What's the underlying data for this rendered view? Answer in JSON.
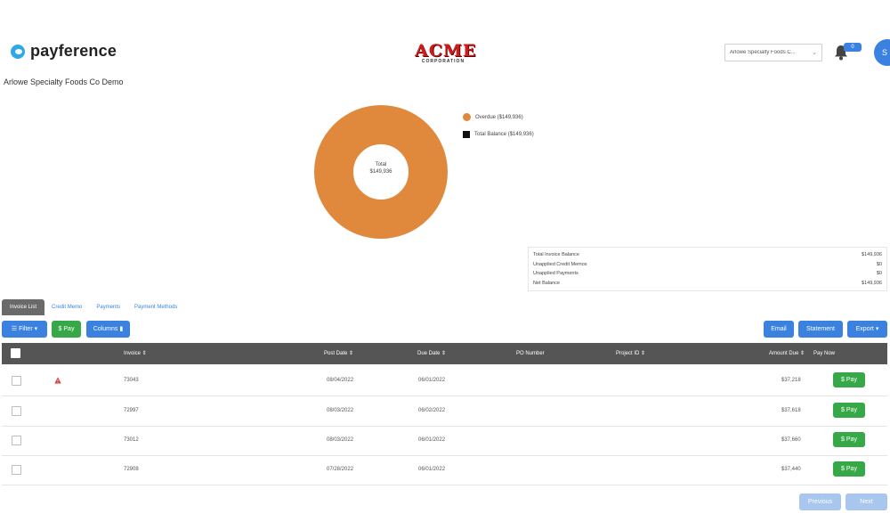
{
  "header": {
    "brand_name": "payference",
    "acme_logo_text": "ACME",
    "acme_logo_subtext": "CORPORATION",
    "account_select_value": "Arlowe Specialty Foods C...",
    "notification_count": "0",
    "avatar_initial": "S"
  },
  "company_name": "Arlowe Specialty Foods Co Demo",
  "chart_data": {
    "type": "pie",
    "categories": [
      "Overdue ($149,936)",
      "Total Balance ($149,936)"
    ],
    "values": [
      149936,
      0
    ],
    "center_label": "Total",
    "center_value": "$149,936",
    "colors": [
      "#e0893d",
      "#111111"
    ],
    "legend_placement": "right"
  },
  "summary": {
    "rows": [
      {
        "label": "Total Invoice Balance",
        "value": "$149,936"
      },
      {
        "label": "Unapplied Credit Memos",
        "value": "$0"
      },
      {
        "label": "Unapplied Payments",
        "value": "$0"
      },
      {
        "label": "Net Balance",
        "value": "$149,936"
      }
    ]
  },
  "tabs": [
    "Invoice List",
    "Credit Memo",
    "Payments",
    "Payment Methods"
  ],
  "toolbar": {
    "filter_label": "Filter",
    "pay_label": "$ Pay",
    "columns_label": "Columns",
    "email_label": "Email",
    "statement_label": "Statement",
    "export_label": "Export"
  },
  "table": {
    "headers": {
      "invoice": "Invoice",
      "post_date": "Post Date",
      "due_date": "Due Date",
      "po_number": "PO Number",
      "project_id": "Project ID",
      "amount_due": "Amount Due",
      "pay_now": "Pay Now"
    },
    "rows": [
      {
        "invoice": "73043",
        "post_date": "08/04/2022",
        "due_date": "06/01/2022",
        "amount_due": "$37,218",
        "warning": true
      },
      {
        "invoice": "72997",
        "post_date": "08/03/2022",
        "due_date": "06/02/2022",
        "amount_due": "$37,618",
        "warning": false
      },
      {
        "invoice": "73012",
        "post_date": "08/03/2022",
        "due_date": "06/01/2022",
        "amount_due": "$37,660",
        "warning": false
      },
      {
        "invoice": "72908",
        "post_date": "07/28/2022",
        "due_date": "06/01/2022",
        "amount_due": "$37,440",
        "warning": false
      }
    ],
    "pay_button_label": "$ Pay"
  },
  "pagination": {
    "previous_label": "Previous",
    "next_label": "Next"
  }
}
